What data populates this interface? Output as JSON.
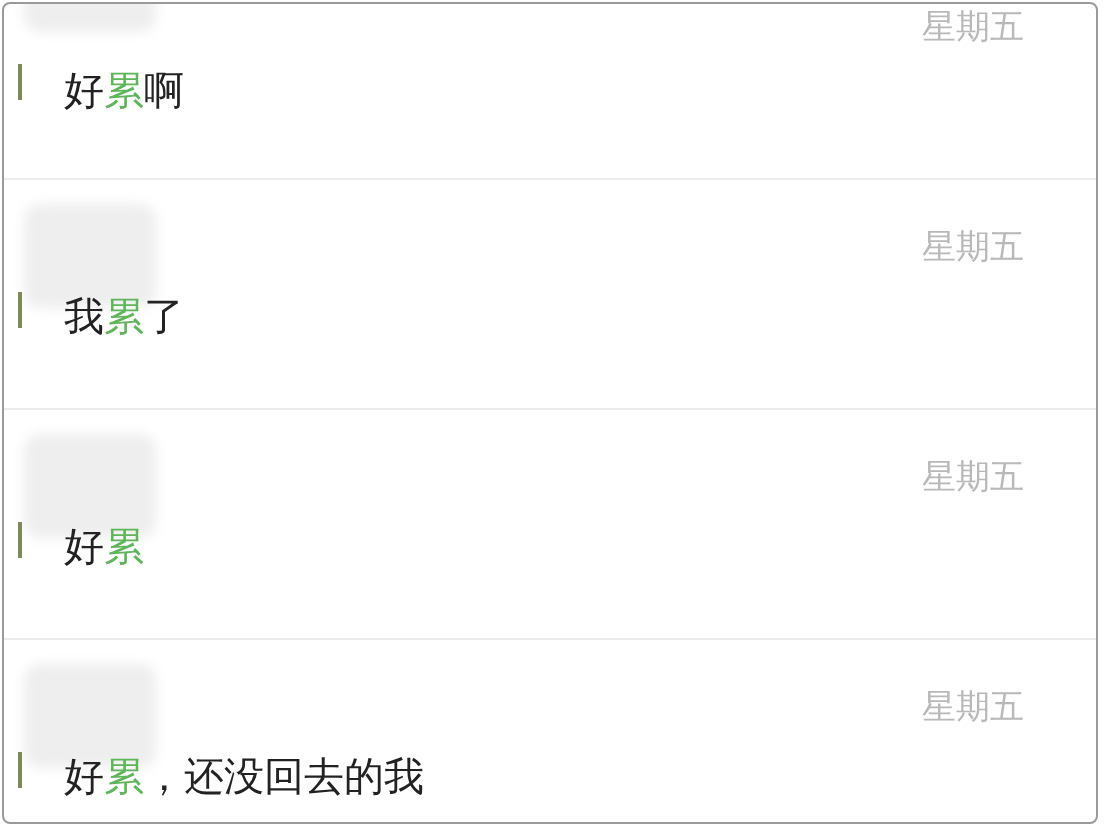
{
  "messages": [
    {
      "time": "星期五",
      "segments": [
        {
          "text": "好",
          "highlight": false
        },
        {
          "text": "累",
          "highlight": true
        },
        {
          "text": "啊",
          "highlight": false
        }
      ]
    },
    {
      "time": "星期五",
      "segments": [
        {
          "text": "我",
          "highlight": false
        },
        {
          "text": "累",
          "highlight": true
        },
        {
          "text": "了",
          "highlight": false
        }
      ]
    },
    {
      "time": "星期五",
      "segments": [
        {
          "text": "好",
          "highlight": false
        },
        {
          "text": "累",
          "highlight": true
        }
      ]
    },
    {
      "time": "星期五",
      "segments": [
        {
          "text": "好",
          "highlight": false
        },
        {
          "text": "累",
          "highlight": true
        },
        {
          "text": "，还没回去的我",
          "highlight": false
        }
      ]
    }
  ]
}
